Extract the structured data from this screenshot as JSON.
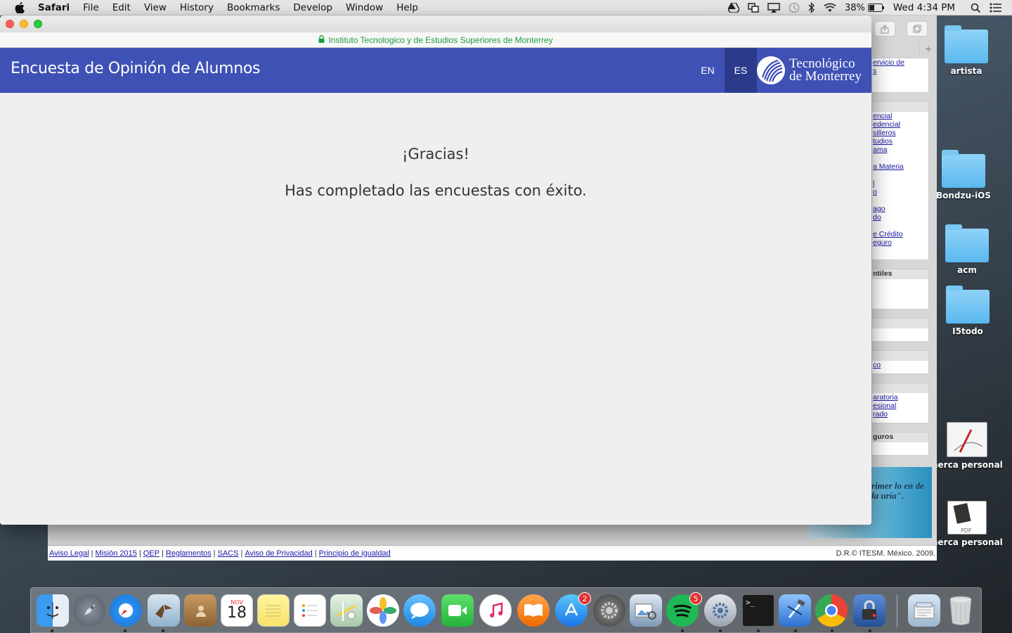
{
  "menubar": {
    "app_name": "Safari",
    "menus": [
      "File",
      "Edit",
      "View",
      "History",
      "Bookmarks",
      "Develop",
      "Window",
      "Help"
    ],
    "battery": "38%",
    "clock": "Wed 4:34 PM"
  },
  "desktop": {
    "icons": [
      "artista",
      "Bondzu-iOS",
      "acm",
      "I5todo",
      "nerca personal",
      "nerca personal"
    ]
  },
  "background_page": {
    "sidebar_links_1": [
      "ervicio de",
      "s"
    ],
    "sidebar_links_2": [
      "encial",
      "edencial",
      "silleros",
      "tudios",
      "ama",
      "a Materia",
      "l",
      "o",
      "ago",
      "do",
      "e Crédito",
      "eguro"
    ],
    "box_header_3": "ntiles",
    "sidebar_links_4": [
      "co"
    ],
    "sidebar_links_5": [
      "aratoria",
      "esional",
      "rado"
    ],
    "box_header_6": "guros",
    "banner_text": "rimer lo en de la uría\".",
    "footer_links": [
      "Aviso Legal",
      "Misión 2015",
      "QEP",
      "Reglamentos",
      "SACS",
      "Aviso de Privacidad",
      "Principio de igualdad"
    ],
    "footer_copyright": "D.R.© ITESM. México. 2009."
  },
  "window": {
    "url_text": "Instituto Tecnologico y de Estudios Superiores de Monterrey",
    "header_title": "Encuesta de Opinión de Alumnos",
    "lang_en": "EN",
    "lang_es": "ES",
    "logo_line1": "Tecnológico",
    "logo_line2": "de Monterrey",
    "thanks_title": "¡Gracias!",
    "thanks_message": "Has completado las encuestas con éxito."
  },
  "dock": {
    "calendar_month": "NOV",
    "calendar_day": "18",
    "appstore_badge": "2",
    "spotify_badge": "5",
    "terminal_prompt": ">_"
  },
  "colors": {
    "header_bg": "#3f51b5",
    "lang_active_bg": "#2c3a8c",
    "secure_green": "#1e9e3a"
  }
}
